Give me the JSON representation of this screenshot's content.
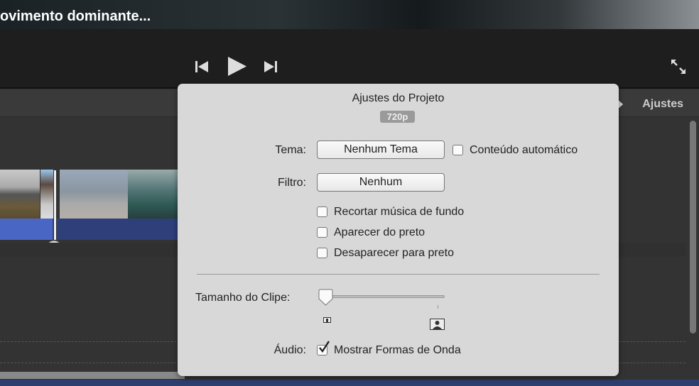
{
  "viewer": {
    "caption": "ovimento dominante..."
  },
  "toolbar": {
    "prev_icon": "skip-back-icon",
    "play_icon": "play-icon",
    "next_icon": "skip-forward-icon",
    "fullscreen_icon": "expand-icon"
  },
  "header": {
    "settings_label": "Ajustes"
  },
  "popover": {
    "title": "Ajustes do Projeto",
    "resolution_badge": "720p",
    "theme_label": "Tema:",
    "theme_value": "Nenhum Tema",
    "auto_content_label": "Conteúdo automático",
    "auto_content_checked": false,
    "filter_label": "Filtro:",
    "filter_value": "Nenhum",
    "options": [
      {
        "label": "Recortar música de fundo",
        "checked": false
      },
      {
        "label": "Aparecer do preto",
        "checked": false
      },
      {
        "label": "Desaparecer para preto",
        "checked": false
      }
    ],
    "clip_size_label": "Tamanho do Clipe:",
    "clip_size_value": 0,
    "audio_label": "Áudio:",
    "waveforms_label": "Mostrar Formas de Onda",
    "waveforms_checked": true
  }
}
